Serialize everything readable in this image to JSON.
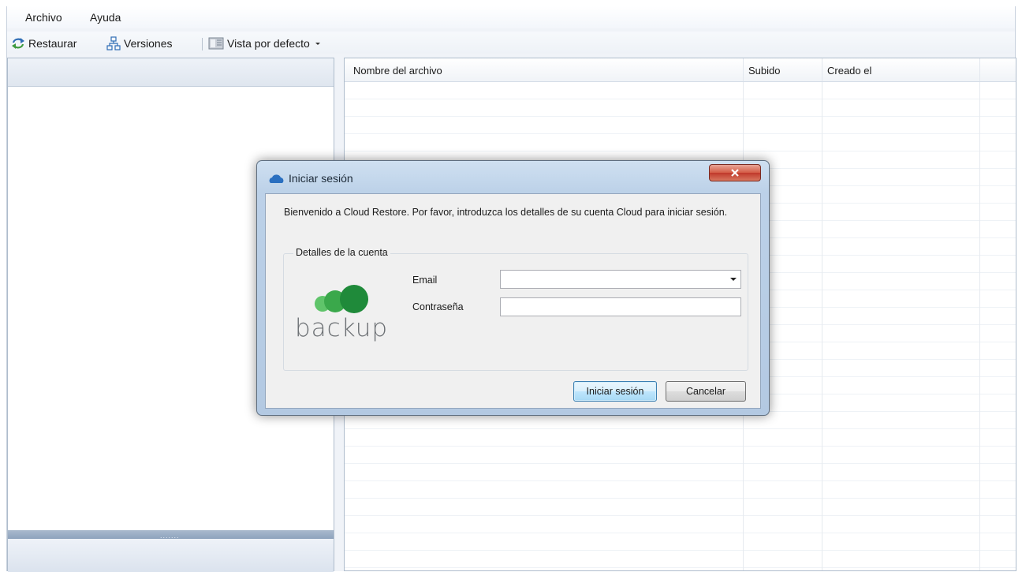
{
  "menu": {
    "items": [
      {
        "label": "Archivo"
      },
      {
        "label": "Ayuda"
      }
    ]
  },
  "toolbar": {
    "restore_label": "Restaurar",
    "versions_label": "Versiones",
    "view_label": "Vista por defecto"
  },
  "grid": {
    "columns": [
      {
        "label": "Nombre del archivo"
      },
      {
        "label": "Subido"
      },
      {
        "label": "Creado el"
      }
    ]
  },
  "dialog": {
    "title": "Iniciar sesión",
    "intro": "Bienvenido a Cloud Restore. Por favor, introduzca los detalles de su cuenta Cloud para iniciar sesión.",
    "group_label": "Detalles de la cuenta",
    "email_label": "Email",
    "email_value": "",
    "password_label": "Contraseña",
    "password_value": "",
    "logo_text": "backup",
    "login_button": "Iniciar sesión",
    "cancel_button": "Cancelar"
  },
  "icons": {
    "restore": "refresh-icon",
    "versions": "hierarchy-icon",
    "view": "table-view-icon",
    "dialog": "cloud-icon",
    "close": "close-icon"
  },
  "colors": {
    "logo_green": "#2fa84f",
    "close_red": "#c0392b",
    "primary_blue": "#3c7fb1"
  }
}
